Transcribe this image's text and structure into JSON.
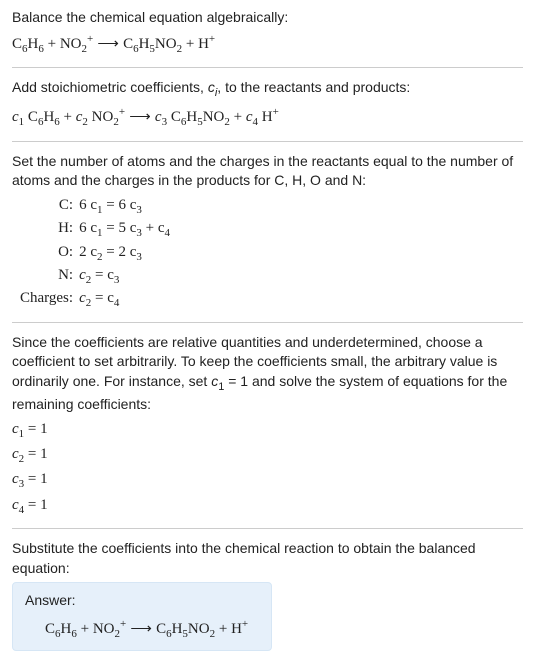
{
  "intro": {
    "t1": "Balance the chemical equation algebraically:"
  },
  "step2": {
    "t1": "Add stoichiometric coefficients, ",
    "ci": "c",
    "ci_sub": "i",
    "t2": ", to the reactants and products:"
  },
  "step3": {
    "t1": "Set the number of atoms and the charges in the reactants equal to the number of atoms and the charges in the products for C, H, O and N:"
  },
  "table": {
    "rows": [
      {
        "label": "C:",
        "lhs": "6 c",
        "lhs_sub": "1",
        "eq": " = 6 c",
        "rhs_sub": "3"
      },
      {
        "label": "H:",
        "lhs": "6 c",
        "lhs_sub": "1",
        "eq": " = 5 c",
        "rhs_sub": "3",
        "extra": " + c",
        "extra_sub": "4"
      },
      {
        "label": "O:",
        "lhs": "2 c",
        "lhs_sub": "2",
        "eq": " = 2 c",
        "rhs_sub": "3"
      },
      {
        "label": "N:",
        "lhs": "c",
        "lhs_sub": "2",
        "eq": " = c",
        "rhs_sub": "3"
      },
      {
        "label": "Charges:",
        "lhs": "c",
        "lhs_sub": "2",
        "eq": " = c",
        "rhs_sub": "4"
      }
    ]
  },
  "step4": {
    "t1": "Since the coefficients are relative quantities and underdetermined, choose a coefficient to set arbitrarily. To keep the coefficients small, the arbitrary value is ordinarily one. For instance, set ",
    "c1": "c",
    "c1_sub": "1",
    "t2": " = 1 and solve the system of equations for the remaining coefficients:"
  },
  "coeffs": {
    "c1": "c",
    "c1s": "1",
    "c1v": " = 1",
    "c2": "c",
    "c2s": "2",
    "c2v": " = 1",
    "c3": "c",
    "c3s": "3",
    "c3v": " = 1",
    "c4": "c",
    "c4s": "4",
    "c4v": " = 1"
  },
  "step5": {
    "t1": "Substitute the coefficients into the chemical reaction to obtain the balanced equation:"
  },
  "answer": {
    "label": "Answer:"
  },
  "chem": {
    "C6H6": "C",
    "H6": "H",
    "NO2": "NO",
    "plus": " + ",
    "arrow": " ⟶ ",
    "C6H5NO2": "C",
    "H5": "H",
    "NO2b": "NO",
    "Hp": "H",
    "six": "6",
    "five": "5",
    "two": "2",
    "sup_plus": "+",
    "c": "c",
    "s1": "1",
    "s2": "2",
    "s3": "3",
    "s4": "4",
    "sp": " "
  }
}
